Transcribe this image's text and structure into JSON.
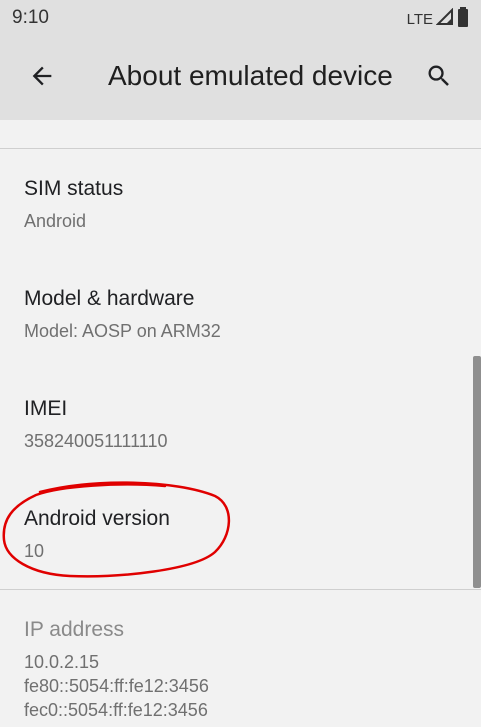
{
  "status_bar": {
    "time": "9:10",
    "network": "LTE",
    "signal_icon": "signal-icon",
    "battery_icon": "battery-icon"
  },
  "app_bar": {
    "title": "About emulated device",
    "back_icon": "back-arrow-icon",
    "search_icon": "search-icon"
  },
  "rows": [
    {
      "title": "SIM status",
      "summary": "Android"
    },
    {
      "title": "Model & hardware",
      "summary": "Model: AOSP on ARM32"
    },
    {
      "title": "IMEI",
      "summary": "358240051111110"
    },
    {
      "title": "Android version",
      "summary": "10"
    },
    {
      "title": "IP address",
      "summary_lines": [
        "10.0.2.15",
        "fe80::5054:ff:fe12:3456",
        "fec0::5054:ff:fe12:3456"
      ]
    }
  ],
  "colors": {
    "annotation": "#e00000",
    "app_bar_bg": "#e0e0e0",
    "page_bg": "#f2f2f2"
  }
}
